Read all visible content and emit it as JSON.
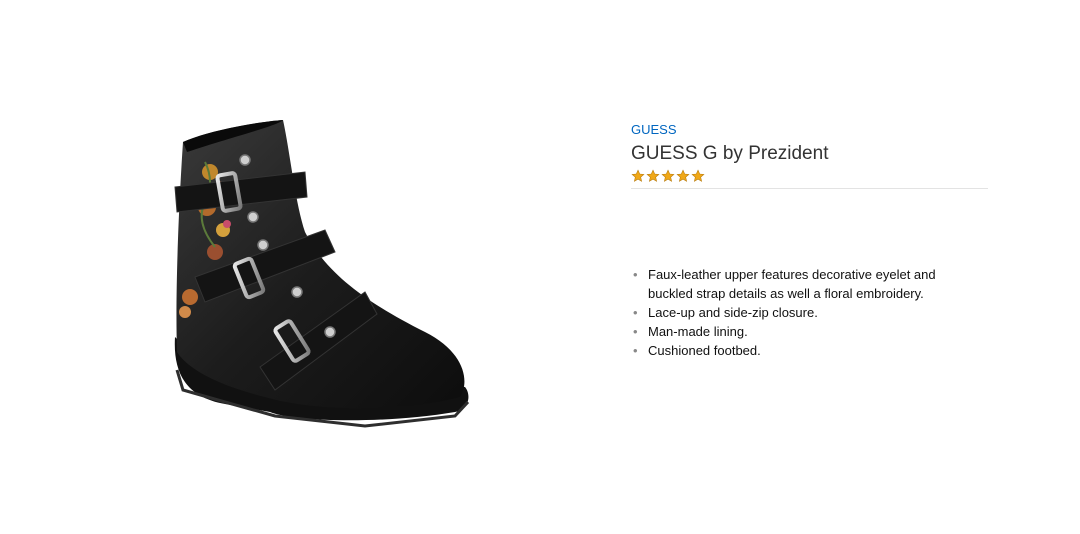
{
  "product": {
    "brand": "GUESS",
    "title": "GUESS G by Prezident",
    "rating": 5,
    "rating_max": 5,
    "image_icon": "black-buckle-boot-image",
    "star_color": "#f0a818",
    "features": [
      "Faux-leather upper features decorative eyelet and buckled strap details as well a floral embroidery.",
      "Lace-up and side-zip closure.",
      "Man-made lining.",
      "Cushioned footbed."
    ]
  }
}
